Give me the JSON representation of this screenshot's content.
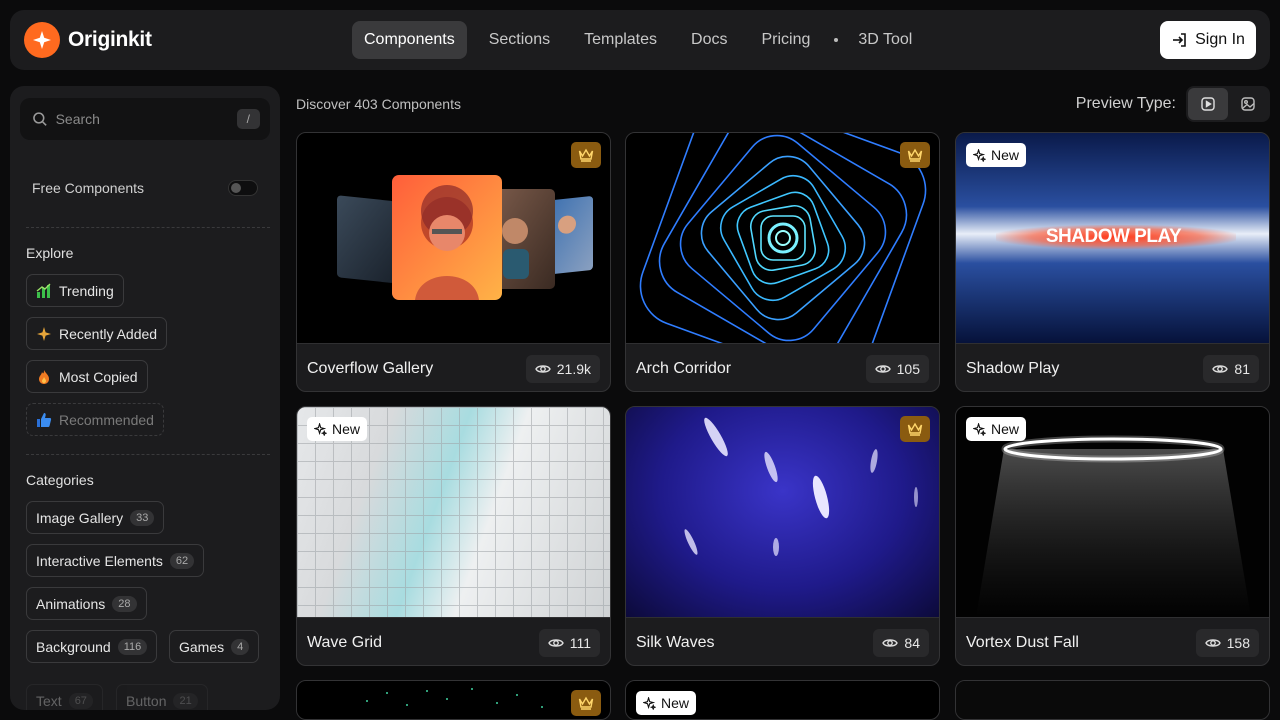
{
  "brand": {
    "name": "Originkit",
    "accent": "#ff6a1f"
  },
  "nav": {
    "links": [
      {
        "label": "Components",
        "active": true
      },
      {
        "label": "Sections"
      },
      {
        "label": "Templates"
      },
      {
        "label": "Docs"
      },
      {
        "label": "Pricing"
      },
      {
        "label": "3D Tool"
      }
    ],
    "sign_in": "Sign In"
  },
  "sidebar": {
    "search": {
      "placeholder": "Search",
      "shortcut": "/"
    },
    "free_components": {
      "label": "Free Components",
      "enabled": false
    },
    "explore": {
      "title": "Explore",
      "items": [
        {
          "label": "Trending",
          "icon": "trending-icon"
        },
        {
          "label": "Recently Added",
          "icon": "sparkle-icon"
        },
        {
          "label": "Most Copied",
          "icon": "flame-icon"
        },
        {
          "label": "Recommended",
          "icon": "thumbs-up-icon"
        }
      ]
    },
    "categories": {
      "title": "Categories",
      "items": [
        {
          "label": "Image Gallery",
          "count": "33"
        },
        {
          "label": "Interactive Elements",
          "count": "62"
        },
        {
          "label": "Animations",
          "count": "28"
        },
        {
          "label": "Background",
          "count": "116"
        },
        {
          "label": "Games",
          "count": "4"
        },
        {
          "label": "Text",
          "count": "67"
        },
        {
          "label": "Button",
          "count": "21"
        }
      ]
    }
  },
  "main": {
    "discover": "Discover 403 Components",
    "preview_type": "Preview Type:",
    "cards": [
      {
        "title": "Coverflow Gallery",
        "views": "21.9k",
        "premium": true,
        "new": false
      },
      {
        "title": "Arch Corridor",
        "views": "105",
        "premium": true,
        "new": false
      },
      {
        "title": "Shadow Play",
        "views": "81",
        "premium": false,
        "new": true,
        "preview_text": "SHADOW PLAY"
      },
      {
        "title": "Wave Grid",
        "views": "111",
        "premium": false,
        "new": true
      },
      {
        "title": "Silk Waves",
        "views": "84",
        "premium": true,
        "new": false
      },
      {
        "title": "Vortex Dust Fall",
        "views": "158",
        "premium": false,
        "new": true
      }
    ],
    "new_label": "New"
  }
}
